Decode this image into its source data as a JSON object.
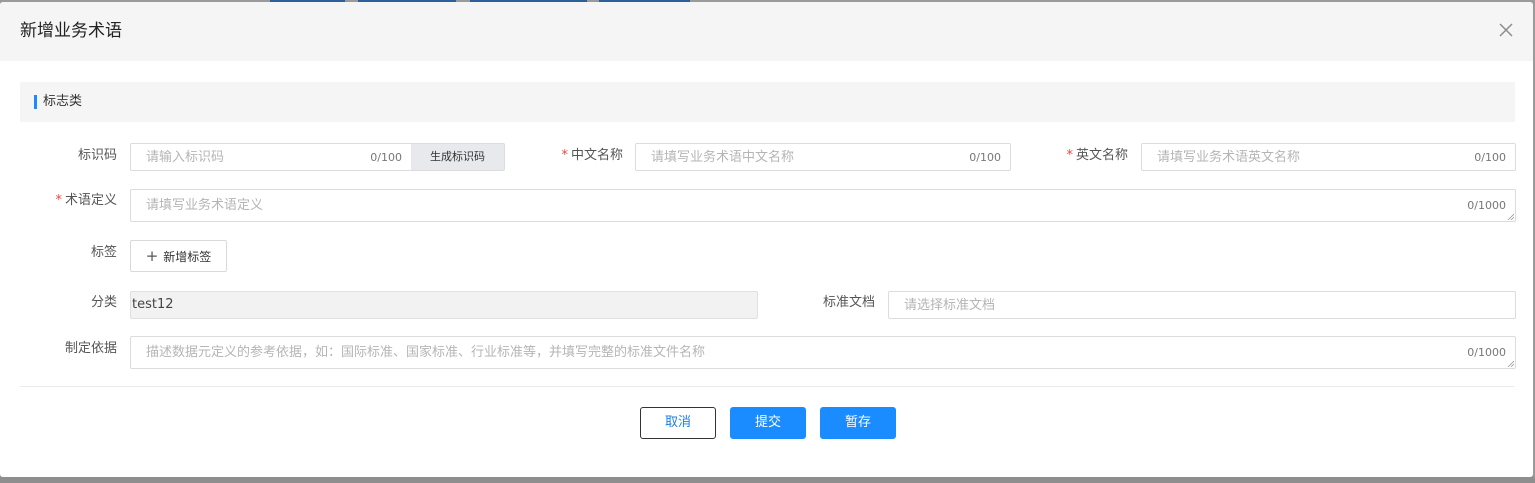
{
  "dialog": {
    "title": "新增业务术语"
  },
  "section": {
    "title": "标志类"
  },
  "form": {
    "code": {
      "label": "标识码",
      "placeholder": "请输入标识码",
      "count": "0/100",
      "generate_button": "生成标识码"
    },
    "cn_name": {
      "required_mark": "*",
      "label": "中文名称",
      "placeholder": "请填写业务术语中文名称",
      "count": "0/100"
    },
    "en_name": {
      "required_mark": "*",
      "label": "英文名称",
      "placeholder": "请填写业务术语英文名称",
      "count": "0/100"
    },
    "definition": {
      "required_mark": "*",
      "label": "术语定义",
      "placeholder": "请填写业务术语定义",
      "count": "0/1000"
    },
    "tags": {
      "label": "标签",
      "add_button": "新增标签",
      "add_icon": "plus-icon"
    },
    "category": {
      "label": "分类",
      "value": "test12"
    },
    "standard_doc": {
      "label": "标准文档",
      "placeholder": "请选择标准文档"
    },
    "basis": {
      "label": "制定依据",
      "placeholder": "描述数据元定义的参考依据，如：国际标准、国家标准、行业标准等，并填写完整的标准文件名称",
      "count": "0/1000"
    }
  },
  "footer": {
    "cancel_label": "取消",
    "submit_label": "提交",
    "draft_label": "暂存"
  },
  "icons": {
    "close": "close-icon",
    "resize": "resize-handle-icon"
  },
  "colors": {
    "primary": "#1a8cff",
    "required": "#f0453a",
    "header_bg": "#f5f5f5"
  }
}
